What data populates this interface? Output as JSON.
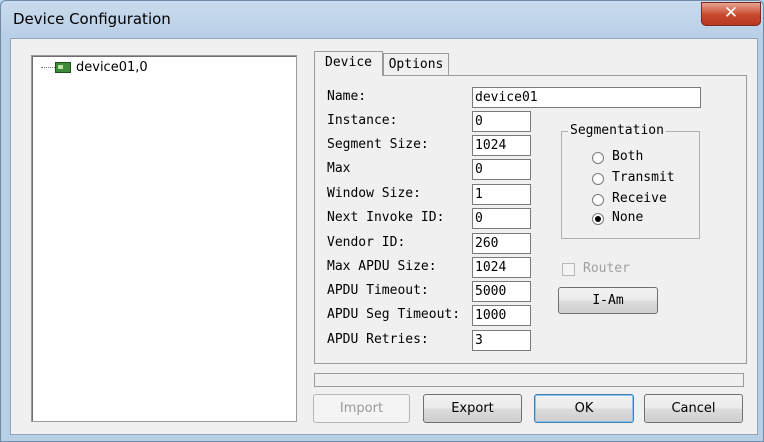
{
  "window": {
    "title": "Device Configuration",
    "close_glyph": "✕"
  },
  "tree": {
    "items": [
      {
        "label": "device01,0",
        "icon": "device-board-icon"
      }
    ]
  },
  "tabs": [
    {
      "label": "Device",
      "active": true
    },
    {
      "label": "Options",
      "active": false
    }
  ],
  "fields": {
    "name": {
      "label": "Name:",
      "value": "device01"
    },
    "instance": {
      "label": "Instance:",
      "value": "0"
    },
    "segment_size": {
      "label": "Segment Size:",
      "value": "1024"
    },
    "max": {
      "label": "Max",
      "value": "0"
    },
    "window_size": {
      "label": "Window Size:",
      "value": "1"
    },
    "next_invoke_id": {
      "label": "Next Invoke ID:",
      "value": "0"
    },
    "vendor_id": {
      "label": "Vendor ID:",
      "value": "260"
    },
    "max_apdu_size": {
      "label": "Max APDU Size:",
      "value": "1024"
    },
    "apdu_timeout": {
      "label": "APDU Timeout:",
      "value": "5000"
    },
    "apdu_seg_timeout": {
      "label": "APDU Seg Timeout:",
      "value": "1000"
    },
    "apdu_retries": {
      "label": "APDU Retries:",
      "value": "3"
    }
  },
  "segmentation": {
    "title": "Segmentation",
    "options": [
      {
        "label": "Both",
        "selected": false
      },
      {
        "label": "Transmit",
        "selected": false
      },
      {
        "label": "Receive",
        "selected": false
      },
      {
        "label": "None",
        "selected": true
      }
    ]
  },
  "router": {
    "label": "Router",
    "checked": false,
    "enabled": false
  },
  "iam_button": "I-Am",
  "buttons": {
    "import": "Import",
    "export": "Export",
    "ok": "OK",
    "cancel": "Cancel"
  }
}
